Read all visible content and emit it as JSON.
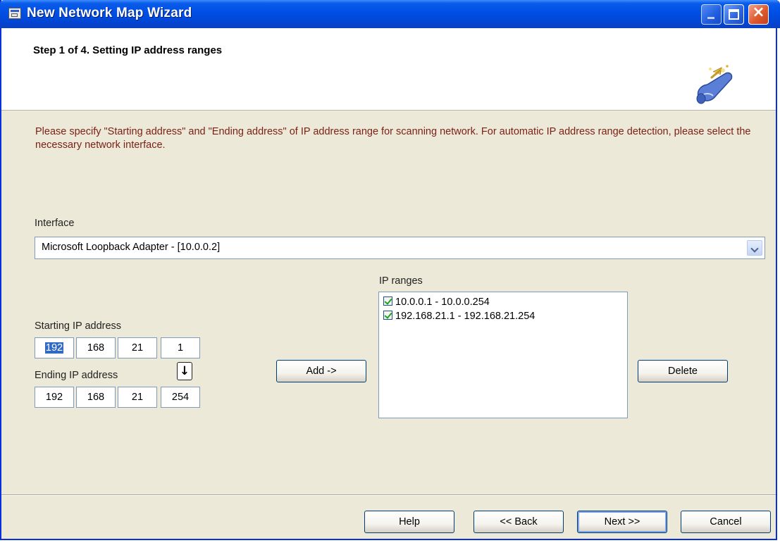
{
  "window": {
    "title": "New Network Map Wizard"
  },
  "header": {
    "step_title": "Step 1 of 4. Setting IP address ranges"
  },
  "description": "Please specify \"Starting address\" and \"Ending address\" of IP address range for scanning network. For automatic IP address range detection, please select the necessary network interface.",
  "interface": {
    "label": "Interface",
    "selected": "Microsoft Loopback Adapter - [10.0.0.2]"
  },
  "starting_ip": {
    "label": "Starting IP address",
    "octets": [
      "192",
      "168",
      "21",
      "1"
    ]
  },
  "ending_ip": {
    "label": "Ending IP address",
    "octets": [
      "192",
      "168",
      "21",
      "254"
    ],
    "copy_icon": "arrow-down-icon"
  },
  "add_button": "Add ->",
  "ip_ranges": {
    "label": "IP ranges",
    "items": [
      {
        "text": "10.0.0.1 - 10.0.0.254",
        "checked": true
      },
      {
        "text": "192.168.21.1 - 192.168.21.254",
        "checked": true
      }
    ]
  },
  "delete_button": "Delete",
  "footer": {
    "help": "Help",
    "back": "<< Back",
    "next": "Next >>",
    "cancel": "Cancel"
  },
  "colors": {
    "titlebar": "#0050e6",
    "description_text": "#7b1f14",
    "dialog_bg": "#ece9d8"
  }
}
